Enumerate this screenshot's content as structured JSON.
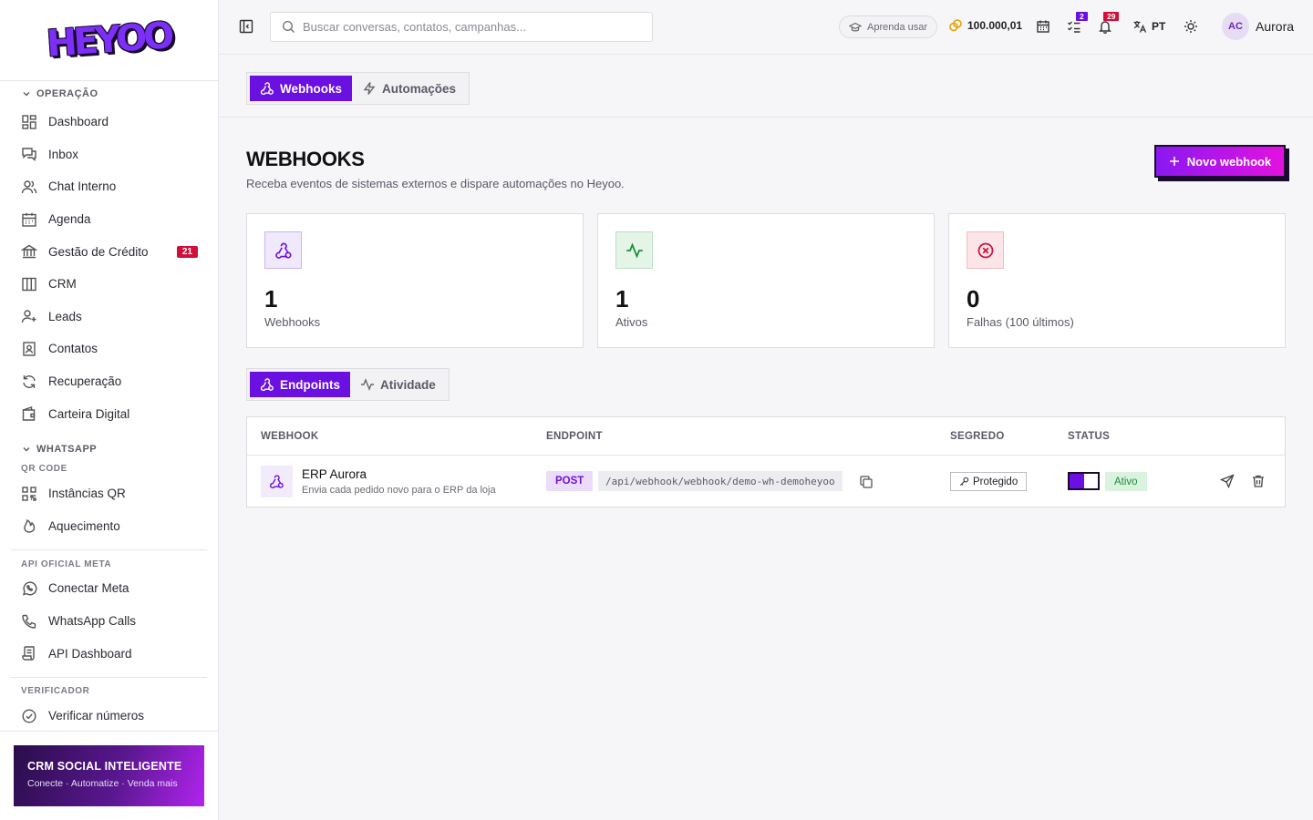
{
  "brand": {
    "logo": "HEYOO"
  },
  "sidebar": {
    "sections": {
      "operacao": "OPERAÇÃO",
      "whatsapp": "WHATSAPP",
      "qr_code": "QR CODE",
      "api_oficial": "API OFICIAL META",
      "verificador": "VERIFICADOR"
    },
    "items": {
      "dashboard": "Dashboard",
      "inbox": "Inbox",
      "chat_interno": "Chat Interno",
      "agenda": "Agenda",
      "gestao_credito": "Gestão de Crédito",
      "gestao_credito_badge": "21",
      "crm": "CRM",
      "leads": "Leads",
      "contatos": "Contatos",
      "recuperacao": "Recuperação",
      "carteira": "Carteira Digital",
      "instancias_qr": "Instâncias QR",
      "aquecimento": "Aquecimento",
      "conectar_meta": "Conectar Meta",
      "whatsapp_calls": "WhatsApp Calls",
      "api_dashboard": "API Dashboard",
      "verificar_numeros": "Verificar números"
    },
    "promo": {
      "title": "CRM SOCIAL INTELIGENTE",
      "subtitle": "Conecte · Automatize · Venda mais"
    }
  },
  "topbar": {
    "search_placeholder": "Buscar conversas, contatos, campanhas...",
    "learn": "Aprenda usar",
    "coins": "100.000,01",
    "tasks_badge": "2",
    "notifications_badge": "29",
    "lang": "PT",
    "avatar_initials": "AC",
    "username": "Aurora"
  },
  "tabs": {
    "webhooks": "Webhooks",
    "automacoes": "Automações"
  },
  "page": {
    "title": "WEBHOOKS",
    "subtitle": "Receba eventos de sistemas externos e dispare automações no Heyoo.",
    "new_button": "Novo webhook"
  },
  "stats": [
    {
      "value": "1",
      "label": "Webhooks"
    },
    {
      "value": "1",
      "label": "Ativos"
    },
    {
      "value": "0",
      "label": "Falhas (100 últimos)"
    }
  ],
  "subtabs": {
    "endpoints": "Endpoints",
    "atividade": "Atividade"
  },
  "table": {
    "headers": {
      "webhook": "WEBHOOK",
      "endpoint": "ENDPOINT",
      "segredo": "SEGREDO",
      "status": "STATUS"
    },
    "rows": [
      {
        "name": "ERP Aurora",
        "description": "Envia cada pedido novo para o ERP da loja",
        "method": "POST",
        "url": "/api/webhook/webhook/demo-wh-demoheyoo",
        "secret": "Protegido",
        "status": "Ativo"
      }
    ]
  },
  "colors": {
    "accent": "#6a10e0",
    "badge": "#d0103a",
    "success": "#1f8a3e"
  }
}
